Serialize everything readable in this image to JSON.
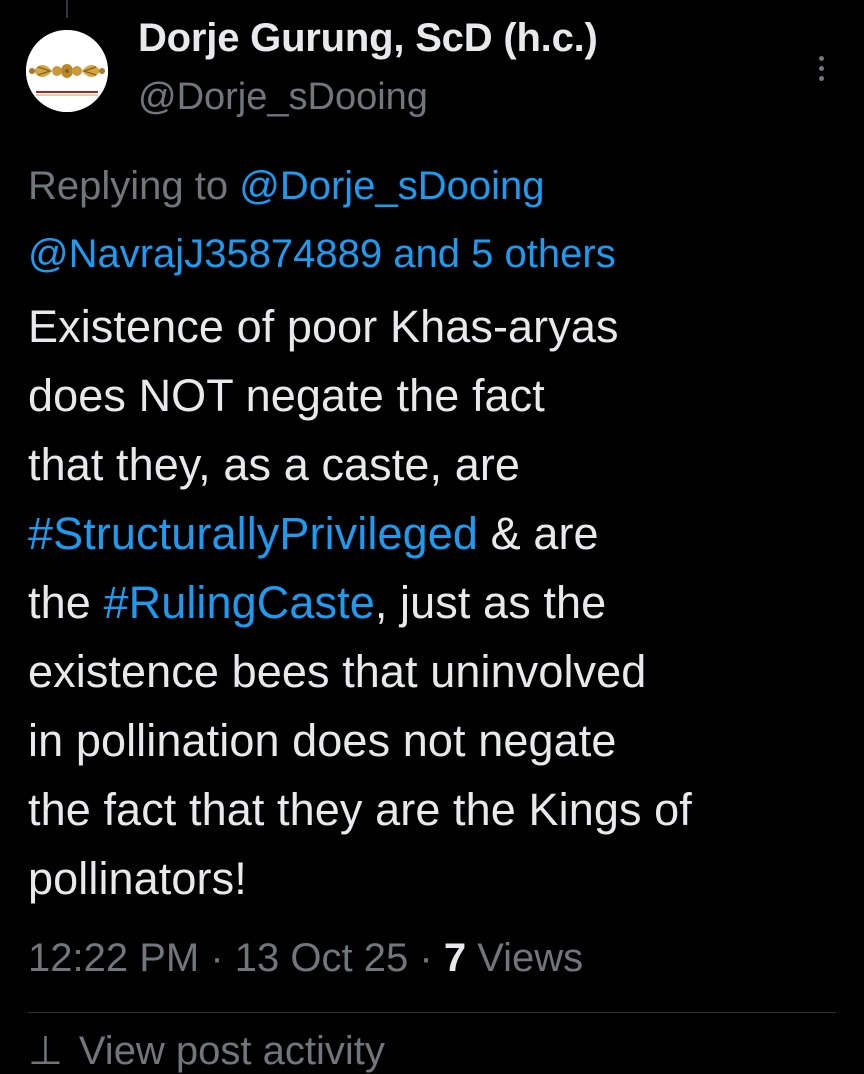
{
  "author": {
    "display_name": "Dorje Gurung, ScD (h.c.)",
    "handle": "@Dorje_sDooing",
    "avatar_icon": "vajra-icon"
  },
  "reply": {
    "prefix": "Replying to",
    "mention_1": "@Dorje_sDooing",
    "mention_2": "@NavrajJ35874889",
    "and_word": "and",
    "others": "5 others"
  },
  "tweet": {
    "line_1": "Existence of poor Khas-aryas",
    "line_2": "does NOT negate the fact",
    "line_3": "that they, as a caste, are",
    "hashtag_1": "#StructurallyPrivileged",
    "line_4_rest": " & are",
    "line_5_start": "the ",
    "hashtag_2": "#RulingCaste",
    "line_5_rest": ", just as the",
    "line_6": "existence bees that uninvolved",
    "line_7": "in pollination does not negate",
    "line_8": "the fact that they are the Kings of",
    "line_9": "pollinators!"
  },
  "meta": {
    "time": "12:22 PM",
    "separator": "·",
    "date": "13 Oct 25",
    "views_count": "7",
    "views_label": "Views"
  },
  "activity": {
    "label": "View post activity"
  },
  "colors": {
    "background": "#000000",
    "text": "#e7e9ea",
    "secondary": "#71767b",
    "link": "#1d9bf0",
    "divider": "#2f3336"
  }
}
